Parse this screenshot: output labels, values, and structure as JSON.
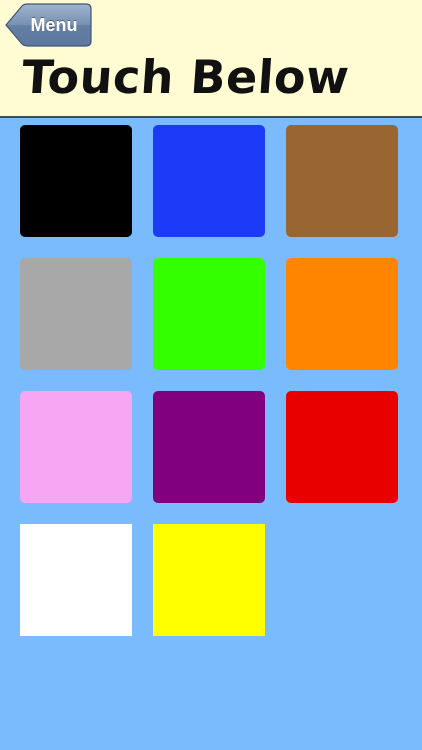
{
  "header": {
    "back_label": "Menu",
    "title": "Touch Below"
  },
  "colors": {
    "background": "#79bbfd",
    "header_background": "#fffcd3",
    "back_button": "#6e8aad"
  },
  "swatches": [
    {
      "name": "black",
      "color": "#000000"
    },
    {
      "name": "blue",
      "color": "#1e3af9"
    },
    {
      "name": "brown",
      "color": "#996633"
    },
    {
      "name": "gray",
      "color": "#a8a8a8"
    },
    {
      "name": "green",
      "color": "#33ff00"
    },
    {
      "name": "orange",
      "color": "#ff8400"
    },
    {
      "name": "pink",
      "color": "#f7a6f3"
    },
    {
      "name": "purple",
      "color": "#800080"
    },
    {
      "name": "red",
      "color": "#e80000"
    },
    {
      "name": "white",
      "color": "#ffffff"
    },
    {
      "name": "yellow",
      "color": "#ffff00"
    }
  ]
}
